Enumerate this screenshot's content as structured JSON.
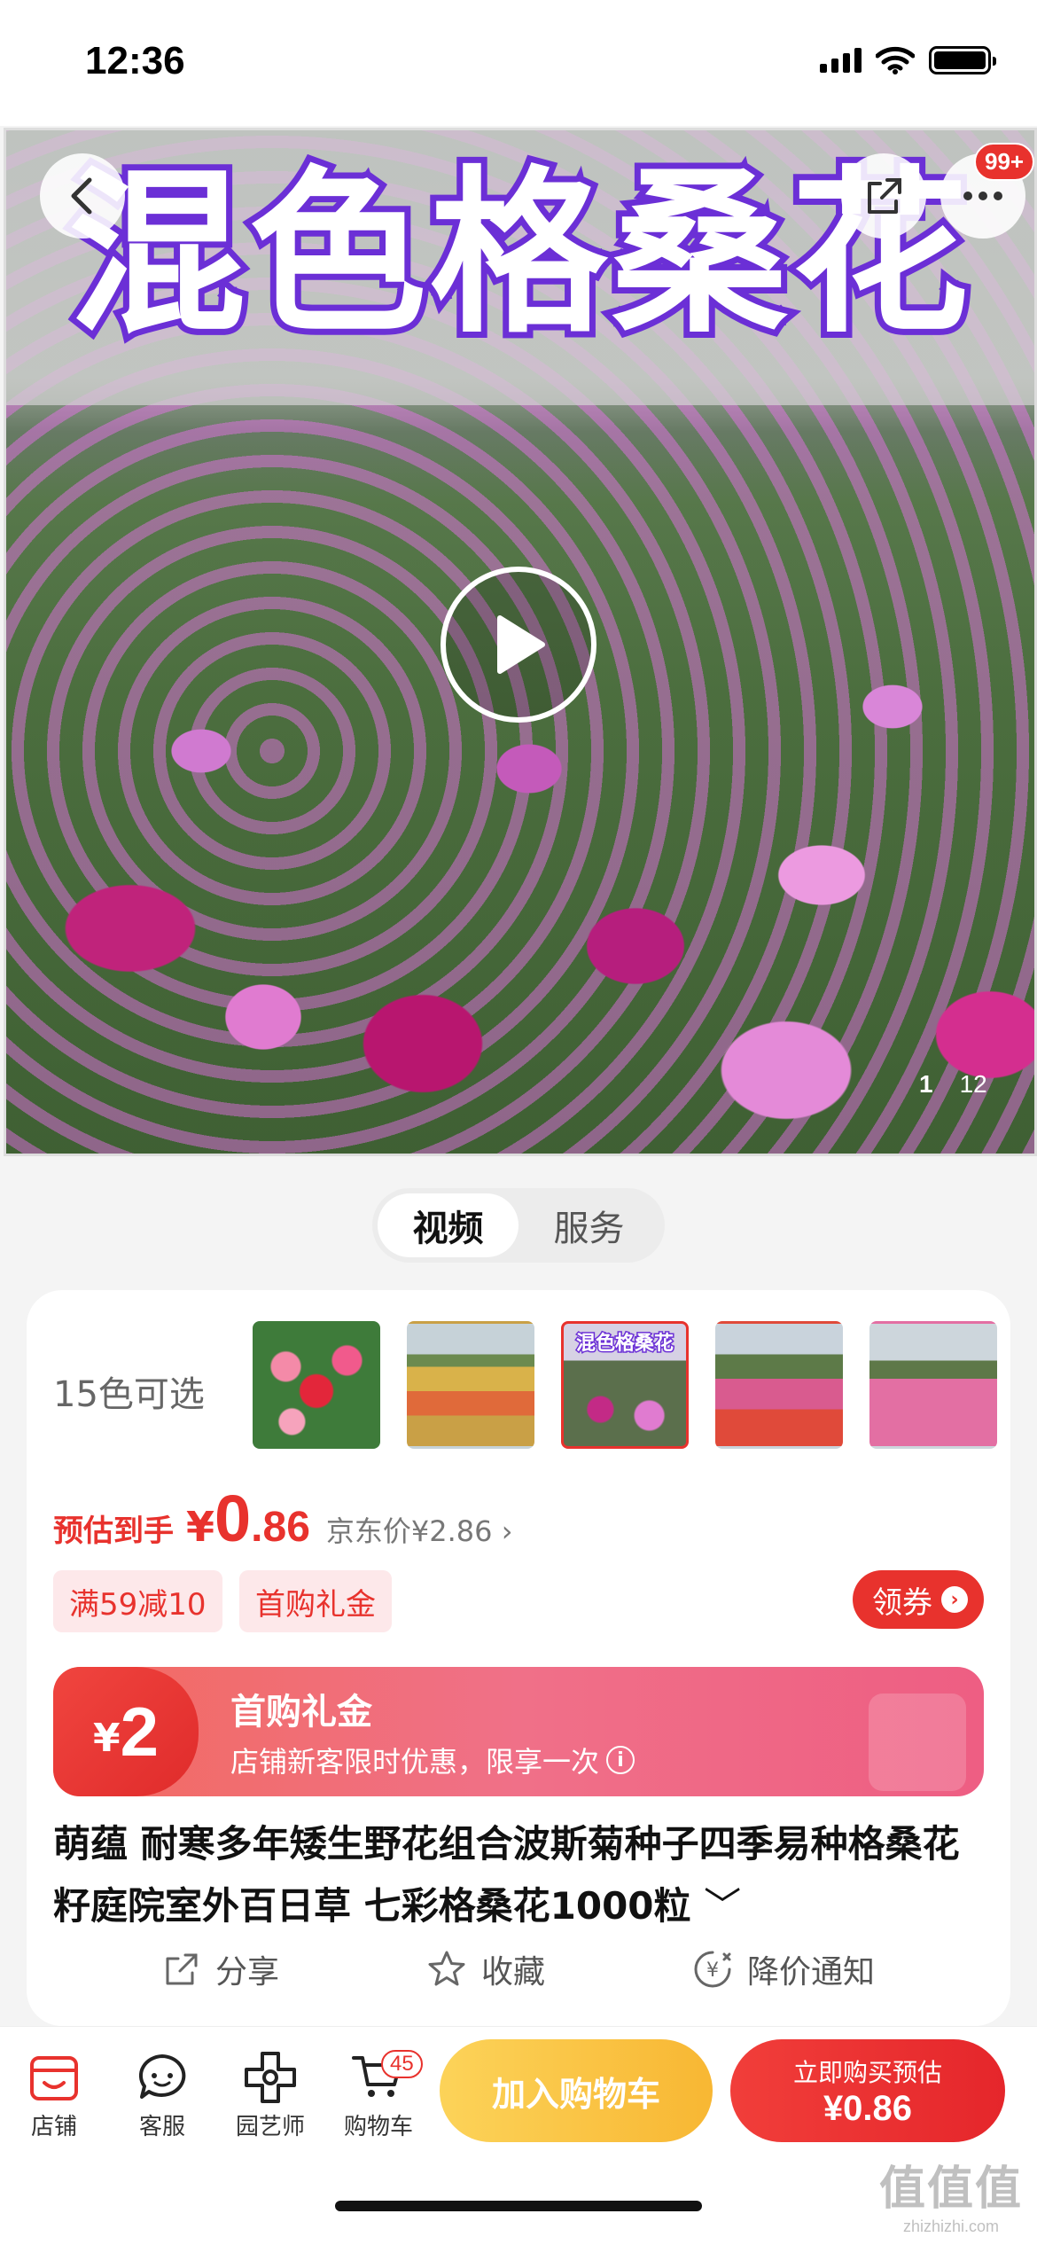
{
  "status_bar": {
    "time": "12:36"
  },
  "hero": {
    "title": "混色格桑花",
    "more_badge": "99+",
    "page_current": "1",
    "page_total": "12"
  },
  "toggle": {
    "video": "视频",
    "service": "服务"
  },
  "variants": {
    "count_label": "15色可选",
    "thumb_overlay": "混色格桑花"
  },
  "price": {
    "label": "预估到手",
    "symbol": "¥",
    "integer": "0",
    "decimal": ".86",
    "jd_price": "京东价¥2.86 ›"
  },
  "tags": {
    "discount": "满59减10",
    "first_gift": "首购礼金"
  },
  "coupon_button": {
    "label": "领券",
    "arrow": "›"
  },
  "gift_banner": {
    "symbol": "¥",
    "amount": "2",
    "title": "首购礼金",
    "subtitle": "店铺新客限时优惠，限享一次",
    "info": "i"
  },
  "product": {
    "title": "萌蕴 耐寒多年矮生野花组合波斯菊种子四季易种格桑花籽庭院室外百日草 七彩格桑花1000粒",
    "chevron": "﹀"
  },
  "actions": {
    "share": "分享",
    "favorite": "收藏",
    "price_alert": "降价通知"
  },
  "bottom_bar": {
    "shop": "店铺",
    "service": "客服",
    "gardener": "园艺师",
    "cart": "购物车",
    "cart_count": "45",
    "add_to_cart": "加入购物车",
    "buy_now_line1": "立即购买预估",
    "buy_now_line2": "¥0.86"
  },
  "watermark": {
    "big": "值值值",
    "small": "zhizhizhi.com"
  },
  "colors": {
    "accent": "#e8322d",
    "title_stroke": "#6b2fd6",
    "cart_button": "#f8b733"
  }
}
